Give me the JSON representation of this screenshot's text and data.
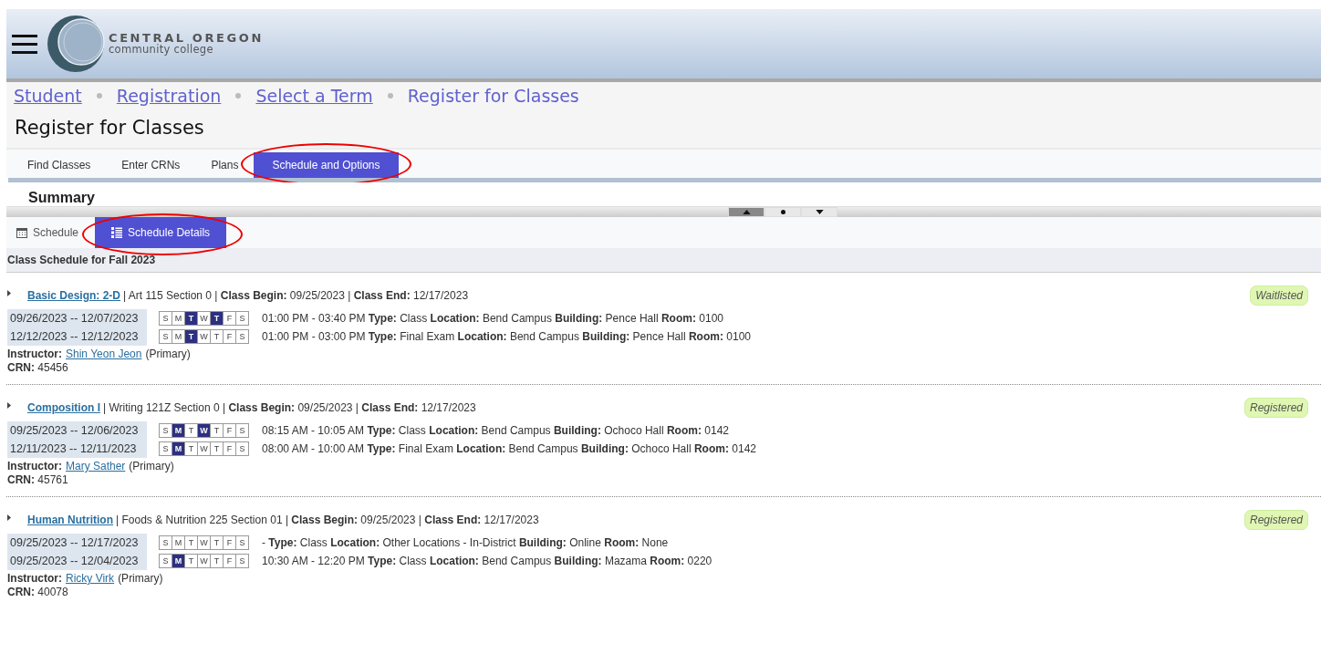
{
  "header": {
    "logo_line_1": "CENTRAL OREGON",
    "logo_line_2": "community college"
  },
  "breadcrumbs": [
    {
      "label": "Student",
      "link": true
    },
    {
      "label": "Registration",
      "link": true
    },
    {
      "label": "Select a Term",
      "link": true
    },
    {
      "label": "Register for Classes",
      "link": false
    }
  ],
  "page_title": "Register for Classes",
  "tabs": [
    {
      "label": "Find Classes",
      "selected": false,
      "circled": false
    },
    {
      "label": "Enter CRNs",
      "selected": false,
      "circled": false
    },
    {
      "label": "Plans",
      "selected": false,
      "circled": false
    },
    {
      "label": "Schedule and Options",
      "selected": true,
      "circled": true
    }
  ],
  "summary": {
    "title": "Summary"
  },
  "splitter_buttons": [
    {
      "kind": "up",
      "selected": true
    },
    {
      "kind": "dot",
      "selected": false
    },
    {
      "kind": "down",
      "selected": false
    }
  ],
  "view_tabs": [
    {
      "label": "Schedule",
      "kind": "calendar",
      "selected": false,
      "circled": false
    },
    {
      "label": "Schedule Details",
      "kind": "list",
      "selected": true,
      "circled": true
    }
  ],
  "schedule_title": "Class Schedule for Fall 2023",
  "courses": [
    {
      "title": "Basic Design: 2-D",
      "info": "| Art 115 Section 0 | **Class Begin:** 09/25/2023 | **Class End:** 12/17/2023",
      "status": "Waitlisted",
      "meetings": [
        {
          "dates": "09/26/2023 -- 12/07/2023",
          "days": [
            {
              "letter": "S",
              "selected": false
            },
            {
              "letter": "M",
              "selected": false
            },
            {
              "letter": "T",
              "selected": true
            },
            {
              "letter": "W",
              "selected": false
            },
            {
              "letter": "T",
              "selected": true
            },
            {
              "letter": "F",
              "selected": false
            },
            {
              "letter": "S",
              "selected": false
            }
          ],
          "details": "01:00 PM - 03:40 PM **Type:** Class **Location:** Bend Campus **Building:** Pence Hall **Room:** 0100"
        },
        {
          "dates": "12/12/2023 -- 12/12/2023",
          "days": [
            {
              "letter": "S",
              "selected": false
            },
            {
              "letter": "M",
              "selected": false
            },
            {
              "letter": "T",
              "selected": true
            },
            {
              "letter": "W",
              "selected": false
            },
            {
              "letter": "T",
              "selected": false
            },
            {
              "letter": "F",
              "selected": false
            },
            {
              "letter": "S",
              "selected": false
            }
          ],
          "details": "01:00 PM - 03:00 PM **Type:** Final Exam **Location:** Bend Campus **Building:** Pence Hall **Room:** 0100"
        }
      ],
      "instructor": {
        "label": "Instructor:",
        "name": "Shin Yeon Jeon",
        "role": "(Primary)"
      },
      "crn": "**CRN:** 45456"
    },
    {
      "title": "Composition I",
      "info": "| Writing 121Z Section 0 | **Class Begin:** 09/25/2023 | **Class End:** 12/17/2023",
      "status": "Registered",
      "meetings": [
        {
          "dates": "09/25/2023 -- 12/06/2023",
          "days": [
            {
              "letter": "S",
              "selected": false
            },
            {
              "letter": "M",
              "selected": true
            },
            {
              "letter": "T",
              "selected": false
            },
            {
              "letter": "W",
              "selected": true
            },
            {
              "letter": "T",
              "selected": false
            },
            {
              "letter": "F",
              "selected": false
            },
            {
              "letter": "S",
              "selected": false
            }
          ],
          "details": "08:15 AM - 10:05 AM **Type:** Class **Location:** Bend Campus **Building:** Ochoco Hall **Room:** 0142"
        },
        {
          "dates": "12/11/2023 -- 12/11/2023",
          "days": [
            {
              "letter": "S",
              "selected": false
            },
            {
              "letter": "M",
              "selected": true
            },
            {
              "letter": "T",
              "selected": false
            },
            {
              "letter": "W",
              "selected": false
            },
            {
              "letter": "T",
              "selected": false
            },
            {
              "letter": "F",
              "selected": false
            },
            {
              "letter": "S",
              "selected": false
            }
          ],
          "details": "08:00 AM - 10:00 AM **Type:** Final Exam **Location:** Bend Campus **Building:** Ochoco Hall **Room:** 0142"
        }
      ],
      "instructor": {
        "label": "Instructor:",
        "name": "Mary Sather",
        "role": "(Primary)"
      },
      "crn": "**CRN:** 45761"
    },
    {
      "title": "Human Nutrition",
      "info": "| Foods & Nutrition 225 Section 01 | **Class Begin:** 09/25/2023 | **Class End:** 12/17/2023",
      "status": "Registered",
      "meetings": [
        {
          "dates": "09/25/2023 -- 12/17/2023",
          "days": [
            {
              "letter": "S",
              "selected": false
            },
            {
              "letter": "M",
              "selected": false
            },
            {
              "letter": "T",
              "selected": false
            },
            {
              "letter": "W",
              "selected": false
            },
            {
              "letter": "T",
              "selected": false
            },
            {
              "letter": "F",
              "selected": false
            },
            {
              "letter": "S",
              "selected": false
            }
          ],
          "details": "- **Type:** Class **Location:** Other Locations - In-District **Building:** Online **Room:** None"
        },
        {
          "dates": "09/25/2023 -- 12/04/2023",
          "days": [
            {
              "letter": "S",
              "selected": false
            },
            {
              "letter": "M",
              "selected": true
            },
            {
              "letter": "T",
              "selected": false
            },
            {
              "letter": "W",
              "selected": false
            },
            {
              "letter": "T",
              "selected": false
            },
            {
              "letter": "F",
              "selected": false
            },
            {
              "letter": "S",
              "selected": false
            }
          ],
          "details": "10:30 AM - 12:20 PM **Type:** Class **Location:** Bend Campus **Building:** Mazama **Room:** 0220"
        }
      ],
      "instructor": {
        "label": "Instructor:",
        "name": "Ricky Virk",
        "role": "(Primary)"
      },
      "crn": "**CRN:** 40078"
    }
  ]
}
